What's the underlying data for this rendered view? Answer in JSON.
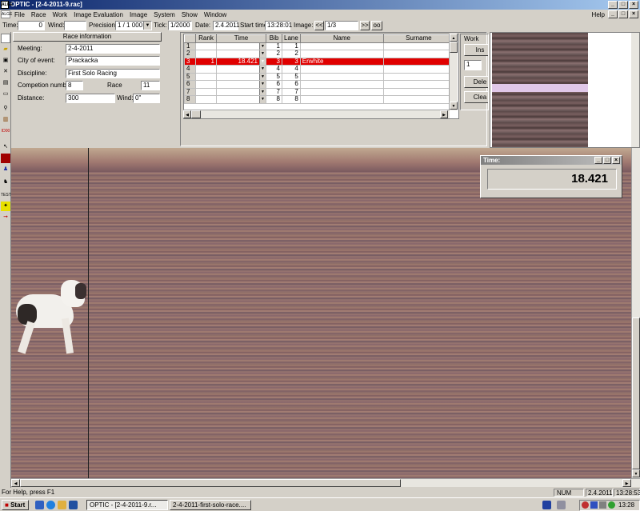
{
  "window": {
    "title": "OPTIC - [2-4-2011-9.rac]",
    "app_icon": "ALGE"
  },
  "menu": {
    "items": [
      "File",
      "Race",
      "Work",
      "Image Evaluation",
      "Image",
      "System",
      "Show",
      "Window"
    ],
    "help": "Help"
  },
  "toolbar": {
    "time_label": "Time:",
    "time_value": "0",
    "wind_label": "Wind:",
    "wind_value": "",
    "precision_label": "Precision:",
    "precision_value": "1 / 1 000",
    "tick_label": "Tick:",
    "tick_value": "1/2000",
    "date_label": "Date:",
    "date_value": "2.4.2011",
    "start_label": "Start time",
    "start_value": "13:28:01",
    "image_label": "Image:",
    "prev": "<<",
    "image_value": "1/3",
    "next": ">>",
    "oo": "oo"
  },
  "race_info": {
    "header": "Race information",
    "meeting_label": "Meeting:",
    "meeting": "2-4-2011",
    "city_label": "City of event:",
    "city": "Prackacka",
    "discipline_label": "Discipline:",
    "discipline": "First Solo Racing",
    "competition_label": "Competion number:",
    "competition": "8",
    "race_label": "Race",
    "race": "11",
    "distance_label": "Distance:",
    "distance": "300",
    "wind_label": "Wind:",
    "wind": "0\""
  },
  "results": {
    "columns": [
      "",
      "Rank",
      "Time",
      "Bib",
      "Lane",
      "Name",
      "Surname"
    ],
    "rows": [
      {
        "n": "1",
        "rank": "",
        "time": "",
        "bib": "1",
        "lane": "1",
        "name": "",
        "surname": ""
      },
      {
        "n": "2",
        "rank": "",
        "time": "",
        "bib": "2",
        "lane": "2",
        "name": "",
        "surname": ""
      },
      {
        "n": "3",
        "rank": "1",
        "time": "18.421",
        "bib": "3",
        "lane": "3",
        "name": "Erwhite",
        "surname": ""
      },
      {
        "n": "4",
        "rank": "",
        "time": "",
        "bib": "4",
        "lane": "4",
        "name": "",
        "surname": ""
      },
      {
        "n": "5",
        "rank": "",
        "time": "",
        "bib": "5",
        "lane": "5",
        "name": "",
        "surname": ""
      },
      {
        "n": "6",
        "rank": "",
        "time": "",
        "bib": "6",
        "lane": "6",
        "name": "",
        "surname": ""
      },
      {
        "n": "7",
        "rank": "",
        "time": "",
        "bib": "7",
        "lane": "7",
        "name": "",
        "surname": ""
      },
      {
        "n": "8",
        "rank": "",
        "time": "",
        "bib": "8",
        "lane": "8",
        "name": "",
        "surname": ""
      }
    ],
    "selected_row": 2
  },
  "work": {
    "title": "Work",
    "insert": "Ins",
    "spinner": "1",
    "delete": "Dele",
    "clear": "Clea"
  },
  "timer": {
    "title": "Time:",
    "value": "18.421"
  },
  "status": {
    "help": "For Help, press F1",
    "num": "NUM",
    "date": "2.4.2011",
    "time": "13:28:53"
  },
  "taskbar": {
    "start": "Start",
    "task1": "OPTIC - [2-4-2011-9.r...",
    "task2": "2-4-2011-first-solo-race....",
    "clock": "13:28"
  },
  "colors": {
    "selected_row": "#e00000",
    "title_bar": "#0a246a",
    "window_bg": "#d4d0c8"
  }
}
